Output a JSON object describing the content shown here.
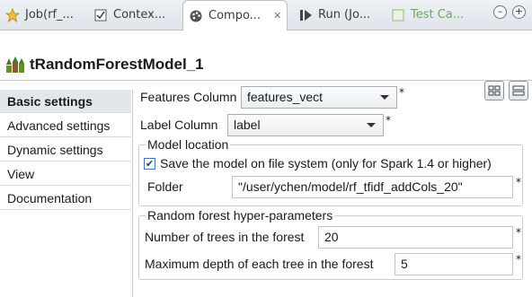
{
  "tabs": [
    {
      "label": "Job(rf_...",
      "icon": "job-icon"
    },
    {
      "label": "Contex...",
      "icon": "context-icon"
    },
    {
      "label": "Compo...",
      "icon": "component-palette-icon",
      "active": true
    },
    {
      "label": "Run (Jo...",
      "icon": "run-icon"
    },
    {
      "label": "Test Ca...",
      "icon": "test-case-icon"
    }
  ],
  "header": {
    "title": "tRandomForestModel_1"
  },
  "sidebar": {
    "items": [
      {
        "label": "Basic settings",
        "active": true
      },
      {
        "label": "Advanced settings"
      },
      {
        "label": "Dynamic settings"
      },
      {
        "label": "View"
      },
      {
        "label": "Documentation"
      }
    ]
  },
  "form": {
    "features_column": {
      "label": "Features Column",
      "value": "features_vect"
    },
    "label_column": {
      "label": "Label Column",
      "value": "label"
    },
    "model_location": {
      "title": "Model location",
      "save_checkbox": {
        "label": "Save the model on file system (only for Spark 1.4 or higher)",
        "checked": true
      },
      "folder": {
        "label": "Folder",
        "value": "\"/user/ychen/model/rf_tfidf_addCols_20\""
      }
    },
    "hyper": {
      "title": "Random forest hyper-parameters",
      "num_trees": {
        "label": "Number of trees in the forest",
        "value": "20"
      },
      "max_depth": {
        "label": "Maximum depth of each tree in the forest",
        "value": "5"
      }
    },
    "required_mark": "*"
  },
  "colors": {
    "accent": "#1a1a1a",
    "test_tab": "#6fa85a"
  }
}
